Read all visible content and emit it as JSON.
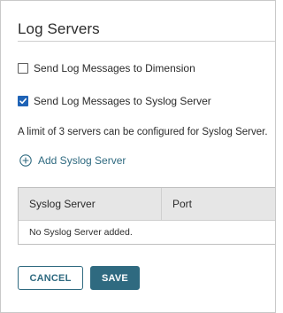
{
  "panel": {
    "title": "Log Servers"
  },
  "options": {
    "dimension": {
      "label": "Send Log Messages to Dimension",
      "checked": false
    },
    "syslog": {
      "label": "Send Log Messages to Syslog Server",
      "checked": true
    }
  },
  "info_text": "A limit of 3 servers can be configured for Syslog Server.",
  "add_link": {
    "label": "Add Syslog Server",
    "icon": "plus-circle-icon"
  },
  "table": {
    "columns": [
      "Syslog Server",
      "Port"
    ],
    "empty_message": "No Syslog Server added."
  },
  "buttons": {
    "cancel": "CANCEL",
    "save": "SAVE"
  },
  "colors": {
    "accent": "#2f6a80",
    "checkbox_checked": "#1f63b6",
    "table_header_bg": "#e6e6e6"
  }
}
